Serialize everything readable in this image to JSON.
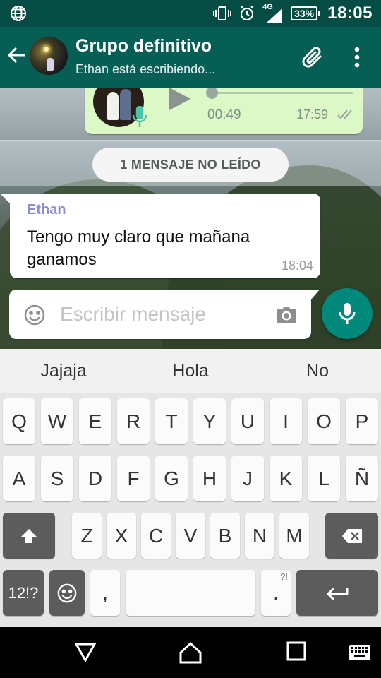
{
  "status_bar": {
    "network": "4G",
    "battery": "33%",
    "time": "18:05"
  },
  "app_bar": {
    "title": "Grupo definitivo",
    "subtitle": "Ethan está escribiendo..."
  },
  "voice_message": {
    "duration": "00:49",
    "time": "17:59",
    "progress": 0.0
  },
  "unread_banner": "1 MENSAJE NO LEÍDO",
  "incoming_message": {
    "sender": "Ethan",
    "text": "Tengo muy claro que mañana ganamos",
    "time": "18:04"
  },
  "compose": {
    "placeholder": "Escribir mensaje",
    "value": ""
  },
  "suggestions": [
    "Jajaja",
    "Hola",
    "No"
  ],
  "keyboard": {
    "row1": [
      "Q",
      "W",
      "E",
      "R",
      "T",
      "Y",
      "U",
      "I",
      "O",
      "P"
    ],
    "row2": [
      "A",
      "S",
      "D",
      "F",
      "G",
      "H",
      "J",
      "K",
      "L",
      "Ñ"
    ],
    "row3": [
      "Z",
      "X",
      "C",
      "V",
      "B",
      "N",
      "M"
    ],
    "symbols_key": "12!?",
    "comma_key": ",",
    "period_key": ".",
    "period_key_sub": "?!"
  },
  "colors": {
    "app_bar": "#075e54",
    "status_bar": "#054d44",
    "outgoing_bubble": "#dcf8c6",
    "fab": "#00897b",
    "sender_name": "#8b8fd1"
  }
}
